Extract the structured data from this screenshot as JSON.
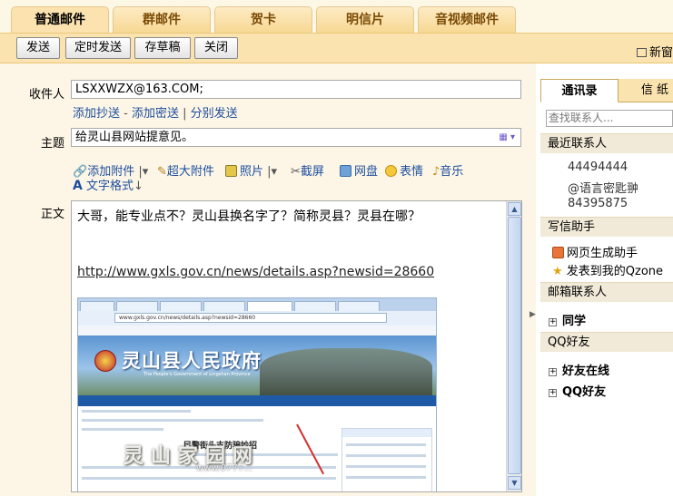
{
  "tabs": [
    {
      "label": "普通邮件",
      "active": true
    },
    {
      "label": "群邮件"
    },
    {
      "label": "贺卡"
    },
    {
      "label": "明信片"
    },
    {
      "label": "音视频邮件"
    }
  ],
  "toolbar": {
    "send": "发送",
    "scheduled_send": "定时发送",
    "save_draft": "存草稿",
    "close": "关闭",
    "new_window": "新窗"
  },
  "compose": {
    "recipient_label": "收件人",
    "recipient_value": "LSXXWZX@163.COM;",
    "add_cc": "添加抄送",
    "add_bcc": "添加密送",
    "separate_send": "分别发送",
    "subject_label": "主题",
    "subject_value": "给灵山县网站提意见。",
    "attach": "添加附件",
    "large_attach": "超大附件",
    "photo": "照片",
    "screenshot": "截屏",
    "netdisk": "网盘",
    "emoji": "表情",
    "music": "音乐",
    "text_format": "文字格式",
    "body_label": "正文",
    "body_text": "大哥，能专业点不？灵山县换名字了？简称灵县？灵县在哪？",
    "body_link": "http://www.gxls.gov.cn/news/details.asp?newsid=28660"
  },
  "embedded_screenshot": {
    "site_title": "灵山县人民政府",
    "site_subtitle": "The People's Government of Lingshan Province",
    "url": "www.gxls.gov.cn/news/details.asp?newsid=28660",
    "headline": "民警街头支防骗妙招",
    "watermark": "灵山家园网",
    "watermark_url": "www.0777..."
  },
  "sidebar": {
    "tab_contacts": "通讯录",
    "tab_letters": "信 纸",
    "search_placeholder": "查找联系人...",
    "recent_title": "最近联系人",
    "recent": [
      "44494444",
      "@语言密匙翀",
      "84395875"
    ],
    "helper_title": "写信助手",
    "helper_items": [
      "网页生成助手",
      "发表到我的Qzone"
    ],
    "mailbox_title": "邮箱联系人",
    "mailbox_groups": [
      "同学"
    ],
    "qq_title": "QQ好友",
    "qq_groups": [
      "好友在线",
      "QQ好友"
    ]
  }
}
